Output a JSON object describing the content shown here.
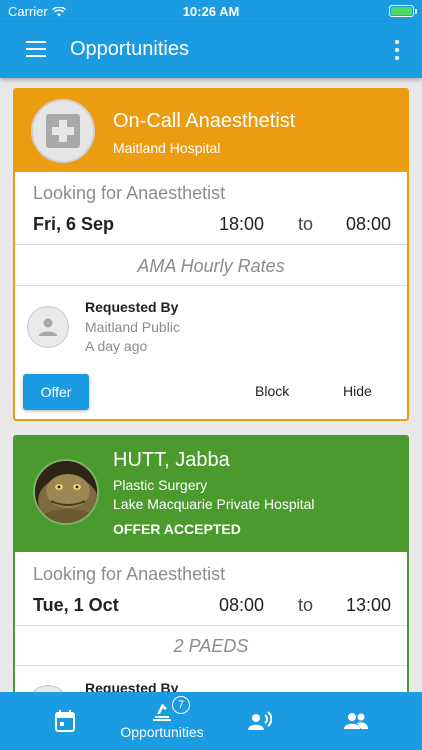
{
  "status_bar": {
    "carrier": "Carrier",
    "time": "10:26 AM"
  },
  "app_bar": {
    "title": "Opportunities"
  },
  "cards": [
    {
      "title": "On-Call Anaesthetist",
      "subtitle": "Maitland Hospital",
      "looking_for": "Looking for Anaesthetist",
      "date": "Fri, 6 Sep",
      "start": "18:00",
      "to": "to",
      "end": "08:00",
      "rates": "AMA Hourly Rates",
      "requested_by_label": "Requested By",
      "requested_by": "Maitland Public",
      "requested_when": "A day ago",
      "actions": {
        "offer": "Offer",
        "block": "Block",
        "hide": "Hide"
      },
      "accent": "#eb9c11"
    },
    {
      "title": "HUTT, Jabba",
      "specialty": "Plastic Surgery",
      "subtitle": "Lake Macquarie Private Hospital",
      "status": "OFFER ACCEPTED",
      "looking_for": "Looking for Anaesthetist",
      "date": "Tue, 1 Oct",
      "start": "08:00",
      "to": "to",
      "end": "13:00",
      "rates": "2 PAEDS",
      "requested_by_label": "Requested By",
      "accent": "#4b9a2e"
    }
  ],
  "bottom_nav": {
    "items": [
      {
        "icon": "calendar-icon",
        "label": ""
      },
      {
        "icon": "opportunities-icon",
        "label": "Opportunities",
        "badge": "7"
      },
      {
        "icon": "contact-icon",
        "label": ""
      },
      {
        "icon": "group-icon",
        "label": ""
      }
    ]
  },
  "colors": {
    "primary": "#1a9be2",
    "orange": "#eb9c11",
    "green": "#4b9a2e",
    "battery": "#4cd964"
  }
}
